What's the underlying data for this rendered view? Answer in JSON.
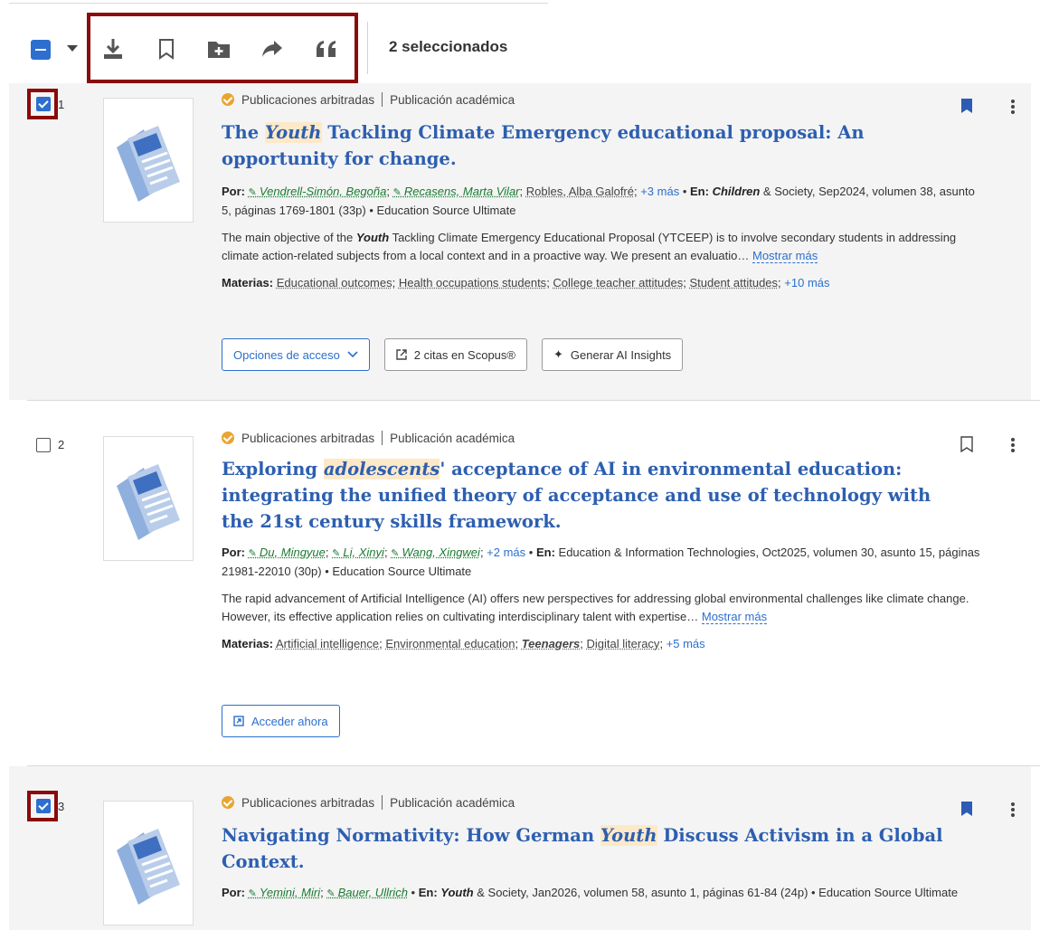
{
  "toolbar": {
    "selected_label": "2 seleccionados",
    "icons": [
      "download-icon",
      "bookmark-icon",
      "add-folder-icon",
      "share-icon",
      "quote-icon"
    ]
  },
  "common": {
    "peer_reviewed": "Publicaciones arbitradas",
    "pub_type": "Publicación académica",
    "by": "Por:",
    "in": "En:",
    "subjects": "Materias:",
    "show_more": "Mostrar más"
  },
  "results": [
    {
      "num": "1",
      "title_pre": "The ",
      "title_hl": "Youth",
      "title_post": " Tackling Climate Emergency educational proposal: An opportunity for change.",
      "authors": [
        "Vendrell-Simón, Begoña",
        "Recasens, Marta Vilar"
      ],
      "author_plain": "Robles, Alba Galofré",
      "authors_more": "+3 más",
      "source_pre": "",
      "source_hl": "Children",
      "source_post": " & Society, Sep2024, volumen 38, asunto 5, páginas 1769-1801 (33p) • Education Source Ultimate",
      "abstract_pre": "The main objective of the ",
      "abstract_hl": "Youth",
      "abstract_post": " Tackling Climate Emergency Educational Proposal (YTCEEP) is to involve secondary students in addressing climate action-related subjects from a local context and in a proactive way. We present an evaluatio…",
      "subjects": [
        "Educational outcomes",
        "Health occupations students",
        "College teacher attitudes",
        "Student attitudes"
      ],
      "subjects_more": "+10 más",
      "buttons": [
        "Opciones de acceso",
        "2 citas en Scopus®",
        "Generar AI Insights"
      ]
    },
    {
      "num": "2",
      "title_pre": "Exploring ",
      "title_hl": "adolescents",
      "title_post": "' acceptance of AI in environmental education: integrating the unified theory of acceptance and use of technology with the 21st century skills framework.",
      "authors": [
        "Du, Mingyue",
        "Li, Xinyi",
        "Wang, Xingwei"
      ],
      "authors_more": "+2 más",
      "source": "Education & Information Technologies, Oct2025, volumen 30, asunto 15, páginas 21981-22010 (30p) • Education Source Ultimate",
      "abstract": "The rapid advancement of Artificial Intelligence (AI) offers new perspectives for addressing global environmental challenges like climate change. However, its effective application relies on cultivating interdisciplinary talent with expertise…",
      "subjects": [
        "Artificial intelligence",
        "Environmental education"
      ],
      "subject_hl": "Teenagers",
      "subject_last": "Digital literacy",
      "subjects_more": "+5 más",
      "buttons": [
        "Acceder ahora"
      ]
    },
    {
      "num": "3",
      "title_pre": "Navigating Normativity: How German ",
      "title_hl": "Youth",
      "title_post": " Discuss Activism in a Global Context.",
      "authors": [
        "Yemini, Miri",
        "Bauer, Ullrich"
      ],
      "source_hl": "Youth",
      "source_post": " & Society, Jan2026, volumen 58, asunto 1, páginas 61-84 (24p) • Education Source Ultimate"
    }
  ]
}
